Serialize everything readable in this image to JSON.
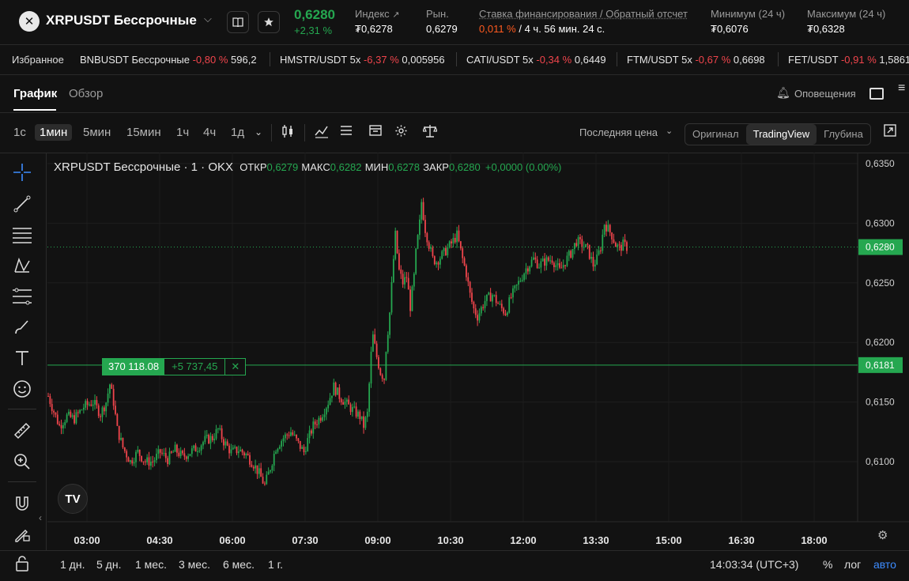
{
  "header": {
    "logo_text": "✕",
    "pair": "XRPUSDT Бессрочные",
    "last_price": "0,6280",
    "change": "+2,31 %",
    "stats": [
      {
        "label": "Индекс",
        "value": "₮0,6278",
        "icon": "external-link-icon"
      },
      {
        "label": "Рын.",
        "value": "0,6279"
      },
      {
        "label": "Ставка финансирования / Обратный отсчет",
        "value_rate": "0,011 %",
        "value_rest": " / 4 ч. 56 мин. 24 с."
      },
      {
        "label": "Минимум (24 ч)",
        "value": "₮0,6076"
      },
      {
        "label": "Максимум (24 ч)",
        "value": "₮0,6328"
      }
    ]
  },
  "ticker": {
    "label": "Избранное",
    "items": [
      {
        "name": "BNBUSDT Бессрочные",
        "change": "-0,80 %",
        "price": "596,2"
      },
      {
        "name": "HMSTR/USDT 5x",
        "change": "-6,37 %",
        "price": "0,005956"
      },
      {
        "name": "CATI/USDT 5x",
        "change": "-0,34 %",
        "price": "0,6449"
      },
      {
        "name": "FTM/USDT 5x",
        "change": "-0,67 %",
        "price": "0,6698"
      },
      {
        "name": "FET/USDT",
        "change": "-0,91 %",
        "price": "1,5861"
      }
    ]
  },
  "tabs": {
    "chart": "График",
    "overview": "Обзор",
    "alerts": "Оповещения"
  },
  "toolbar": {
    "intervals": [
      "1с",
      "1мин",
      "5мин",
      "15мин",
      "1ч",
      "4ч",
      "1д"
    ],
    "selected_interval": "1мин",
    "price_type": "Последняя цена",
    "views": [
      "Оригинал",
      "TradingView",
      "Глубина"
    ],
    "selected_view": "TradingView"
  },
  "chart_data": {
    "type": "candlestick",
    "legend": {
      "symbol": "XRPUSDT Бессрочные · 1 · OKX",
      "open_label": "ОТКР",
      "open": "0,6279",
      "high_label": "МАКС",
      "high": "0,6282",
      "low_label": "МИН",
      "low": "0,6278",
      "close_label": "ЗАКР",
      "close": "0,6280",
      "change": "+0,0000 (0.00%)"
    },
    "y_ticks": [
      "0,6350",
      "0,6300",
      "0,6250",
      "0,6200",
      "0,6150",
      "0,6100"
    ],
    "y_tick_values": [
      0.635,
      0.63,
      0.625,
      0.62,
      0.615,
      0.61
    ],
    "x_ticks": [
      "03:00",
      "04:30",
      "06:00",
      "07:30",
      "09:00",
      "10:30",
      "12:00",
      "13:30",
      "15:00",
      "16:30",
      "18:00"
    ],
    "current_price": 0.628,
    "current_price_label": "0,6280",
    "position_line": {
      "price": 0.6181,
      "price_label": "0,6181",
      "size": "370 118.08",
      "pnl": "+5 737,45"
    },
    "colors": {
      "up": "#25a750",
      "down": "#f0454c",
      "line": "#25a750"
    },
    "path": [
      [
        0,
        0.6155
      ],
      [
        3,
        0.6142
      ],
      [
        6,
        0.613
      ],
      [
        10,
        0.6138
      ],
      [
        14,
        0.6136
      ],
      [
        19,
        0.6146
      ],
      [
        24,
        0.615
      ],
      [
        28,
        0.614
      ],
      [
        31,
        0.615
      ],
      [
        33,
        0.6165
      ],
      [
        35,
        0.615
      ],
      [
        37,
        0.6127
      ],
      [
        40,
        0.6112
      ],
      [
        44,
        0.61
      ],
      [
        48,
        0.6108
      ],
      [
        52,
        0.61
      ],
      [
        56,
        0.61
      ],
      [
        60,
        0.6108
      ],
      [
        64,
        0.6102
      ],
      [
        68,
        0.611
      ],
      [
        72,
        0.6104
      ],
      [
        76,
        0.6108
      ],
      [
        80,
        0.6112
      ],
      [
        84,
        0.6118
      ],
      [
        88,
        0.612
      ],
      [
        91,
        0.6127
      ],
      [
        94,
        0.6117
      ],
      [
        98,
        0.6108
      ],
      [
        102,
        0.611
      ],
      [
        106,
        0.6106
      ],
      [
        110,
        0.6098
      ],
      [
        113,
        0.609
      ],
      [
        116,
        0.608
      ],
      [
        119,
        0.6095
      ],
      [
        122,
        0.6112
      ],
      [
        126,
        0.612
      ],
      [
        130,
        0.6125
      ],
      [
        134,
        0.6115
      ],
      [
        137,
        0.6108
      ],
      [
        139,
        0.6118
      ],
      [
        142,
        0.613
      ],
      [
        146,
        0.6138
      ],
      [
        150,
        0.615
      ],
      [
        153,
        0.6163
      ],
      [
        156,
        0.6155
      ],
      [
        160,
        0.6148
      ],
      [
        164,
        0.6142
      ],
      [
        167,
        0.6138
      ],
      [
        169,
        0.613
      ],
      [
        171,
        0.614
      ],
      [
        172,
        0.6165
      ],
      [
        173,
        0.619
      ],
      [
        174,
        0.6205
      ],
      [
        176,
        0.6188
      ],
      [
        178,
        0.6175
      ],
      [
        180,
        0.617
      ],
      [
        181,
        0.6195
      ],
      [
        183,
        0.6225
      ],
      [
        185,
        0.627
      ],
      [
        186,
        0.629
      ],
      [
        188,
        0.626
      ],
      [
        190,
        0.625
      ],
      [
        192,
        0.6255
      ],
      [
        194,
        0.623
      ],
      [
        196,
        0.6255
      ],
      [
        197,
        0.6275
      ],
      [
        199,
        0.63
      ],
      [
        200,
        0.6318
      ],
      [
        202,
        0.6295
      ],
      [
        204,
        0.6282
      ],
      [
        206,
        0.627
      ],
      [
        208,
        0.6268
      ],
      [
        212,
        0.6275
      ],
      [
        216,
        0.6283
      ],
      [
        219,
        0.629
      ],
      [
        222,
        0.627
      ],
      [
        224,
        0.6258
      ],
      [
        226,
        0.624
      ],
      [
        228,
        0.6228
      ],
      [
        230,
        0.6222
      ],
      [
        234,
        0.6235
      ],
      [
        238,
        0.624
      ],
      [
        242,
        0.623
      ],
      [
        245,
        0.6225
      ],
      [
        248,
        0.6238
      ],
      [
        252,
        0.625
      ],
      [
        256,
        0.6262
      ],
      [
        260,
        0.627
      ],
      [
        263,
        0.6265
      ],
      [
        266,
        0.6268
      ],
      [
        270,
        0.627
      ],
      [
        274,
        0.626
      ],
      [
        277,
        0.6268
      ],
      [
        280,
        0.6275
      ],
      [
        283,
        0.6285
      ],
      [
        286,
        0.6282
      ],
      [
        289,
        0.6278
      ],
      [
        292,
        0.6265
      ],
      [
        294,
        0.627
      ],
      [
        296,
        0.628
      ],
      [
        298,
        0.63
      ],
      [
        300,
        0.6295
      ],
      [
        302,
        0.629
      ],
      [
        304,
        0.6282
      ],
      [
        306,
        0.6279
      ],
      [
        308,
        0.6282
      ],
      [
        310,
        0.628
      ]
    ]
  },
  "bottom": {
    "ranges": [
      "1 дн.",
      "5 дн.",
      "1 мес.",
      "3 мес.",
      "6 мес.",
      "1 г."
    ],
    "clock": "14:03:34 (UTC+3)",
    "percent": "%",
    "log": "лог",
    "auto": "авто"
  }
}
